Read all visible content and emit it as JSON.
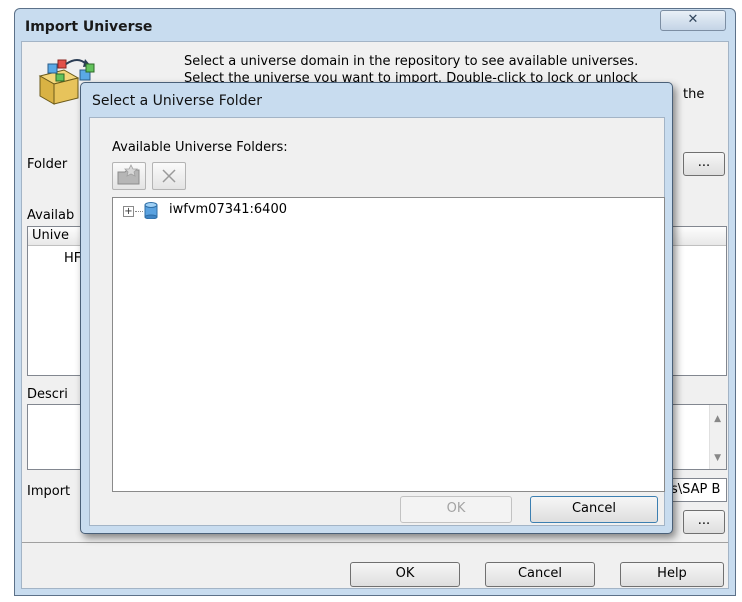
{
  "outer_dialog": {
    "title": "Import Universe",
    "close_glyph": "✕",
    "instructions": {
      "line1": "Select a universe domain in the repository to see available universes.",
      "line2": "Select the universe you want to import. Double-click to lock or unlock",
      "line3": "the"
    },
    "folder_label": "Folder",
    "browse_button": "...",
    "available_label": "Availab",
    "table_header": "Unive",
    "row_1": "HF",
    "description_label": "Descri",
    "import_label": "Import",
    "import_path": "s\\SAP B",
    "browse_button_2": "...",
    "buttons": {
      "ok": "OK",
      "cancel": "Cancel",
      "help": "Help"
    }
  },
  "inner_dialog": {
    "title": "Select a Universe Folder",
    "folders_label": "Available Universe Folders:",
    "toolbar": {
      "new_folder_icon": "new-folder-icon",
      "delete_icon": "delete-icon"
    },
    "tree": {
      "expander": "+",
      "root_node": "iwfvm07341:6400"
    },
    "buttons": {
      "ok": "OK",
      "cancel": "Cancel"
    }
  }
}
